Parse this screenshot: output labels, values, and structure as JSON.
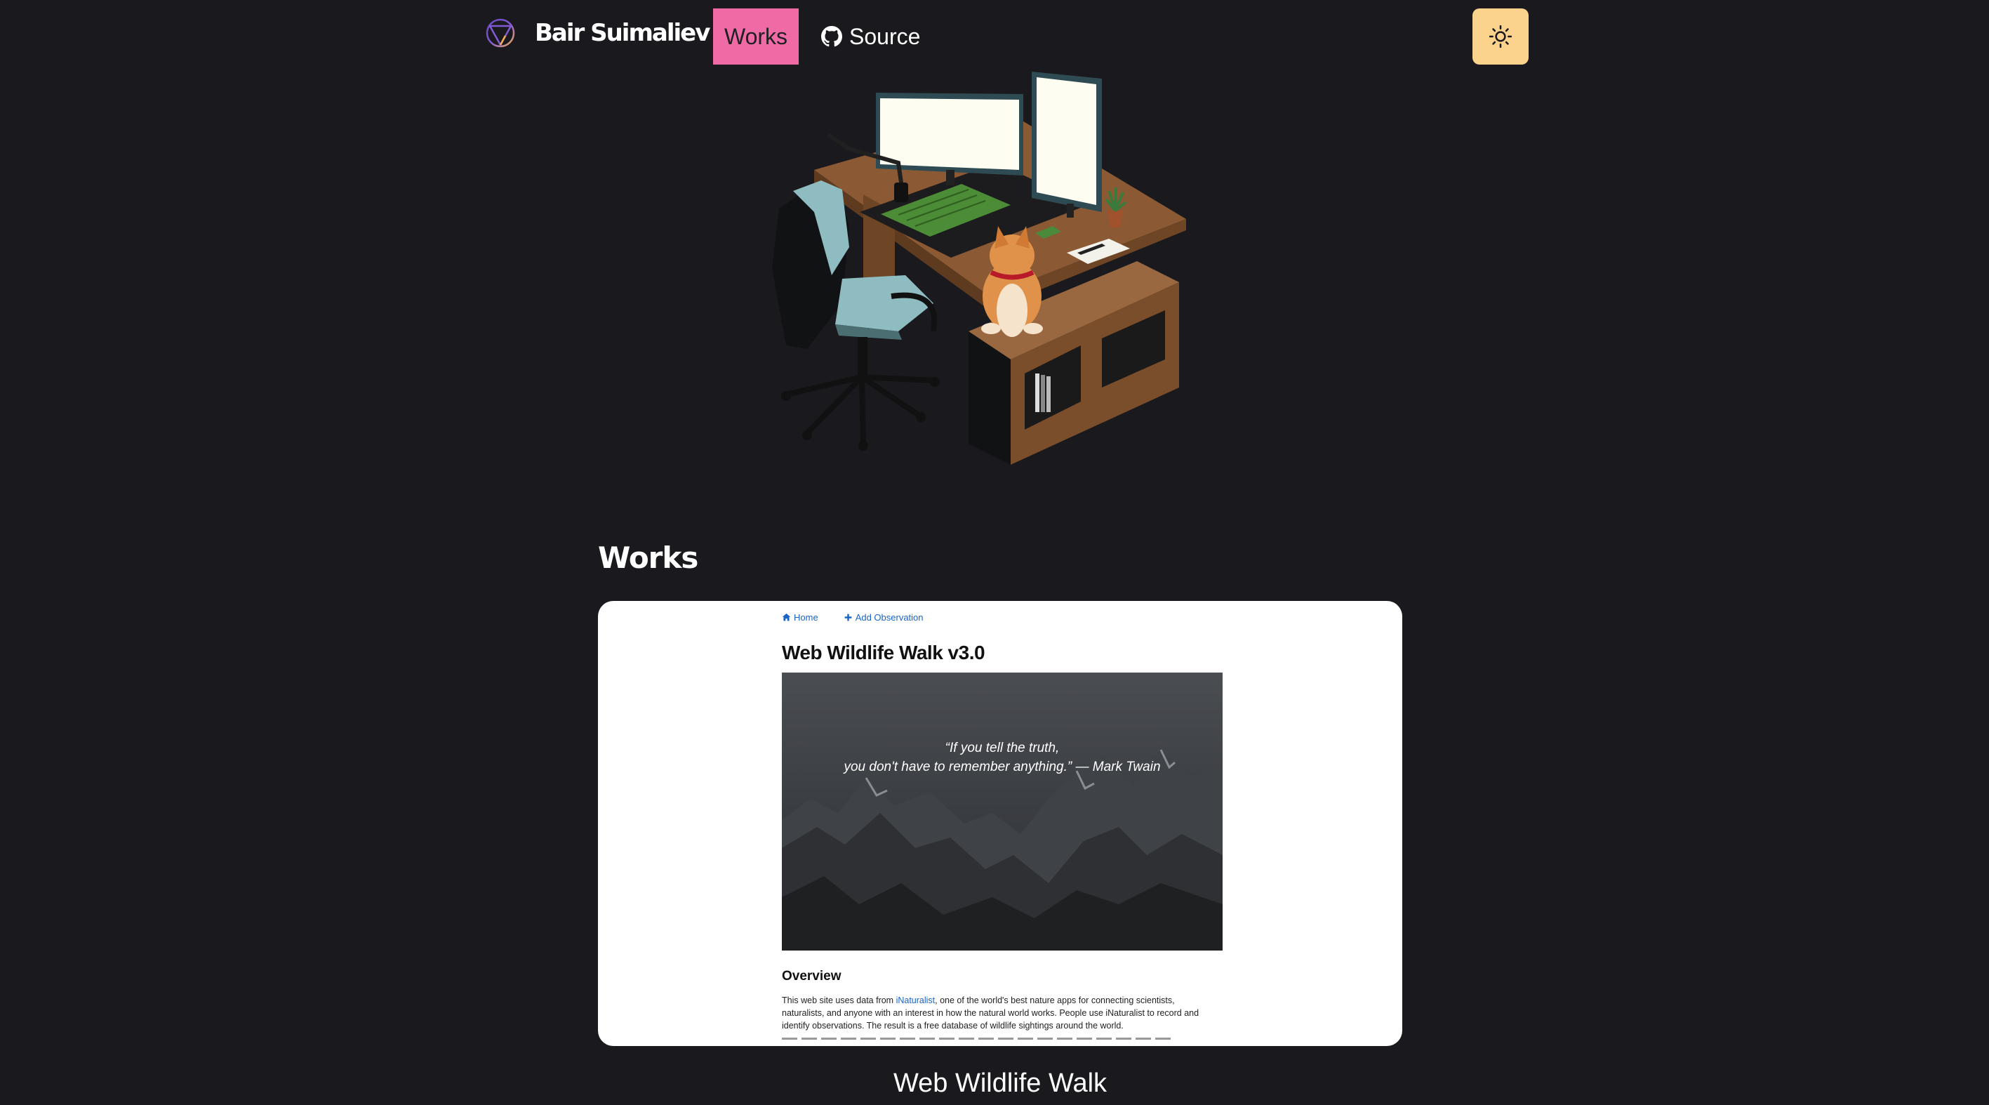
{
  "header": {
    "brand": "Bair Suimaliev",
    "nav": {
      "works_label": "Works",
      "source_label": "Source"
    },
    "theme_toggle_icon": "sun-icon",
    "accent_color": "#f06ba6",
    "toggle_color": "#fbd38d"
  },
  "hero_illustration": {
    "description_icon": "desk-scene-icon"
  },
  "works": {
    "section_title": "Works",
    "items": [
      {
        "caption": "Web Wildlife Walk",
        "preview": {
          "nav_home": "Home",
          "nav_add": "Add Observation",
          "title": "Web Wildlife Walk v3.0",
          "quote_line1": "“If you tell the truth,",
          "quote_line2": "you don't have to remember anything.” — Mark Twain",
          "overview_heading": "Overview",
          "overview_before_link": "This web site uses data from ",
          "overview_link": "iNaturalist",
          "overview_after_link": ", one of the world's best nature apps for connecting scientists, naturalists, and anyone with an interest in how the natural world works. People use iNaturalist to record and identify observations. The result is a free database of wildlife sightings around the world."
        }
      }
    ]
  }
}
